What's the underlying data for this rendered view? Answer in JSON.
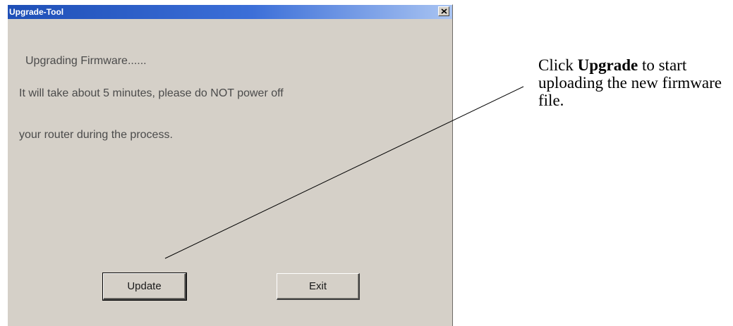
{
  "window": {
    "title": "Upgrade-Tool",
    "close_icon": "close-icon"
  },
  "messages": {
    "line1": "Upgrading Firmware......",
    "line2": "It will take about 5 minutes, please do NOT power off",
    "line3": "your router during the process."
  },
  "buttons": {
    "update_label": "Update",
    "exit_label": "Exit"
  },
  "callout": {
    "prefix": "Click ",
    "bold": "Upgrade",
    "suffix": " to start uploading the new firmware file."
  },
  "colors": {
    "dialog_bg": "#d5d0c8",
    "titlebar_start": "#1e4fb7",
    "titlebar_end": "#a9c4f2"
  }
}
